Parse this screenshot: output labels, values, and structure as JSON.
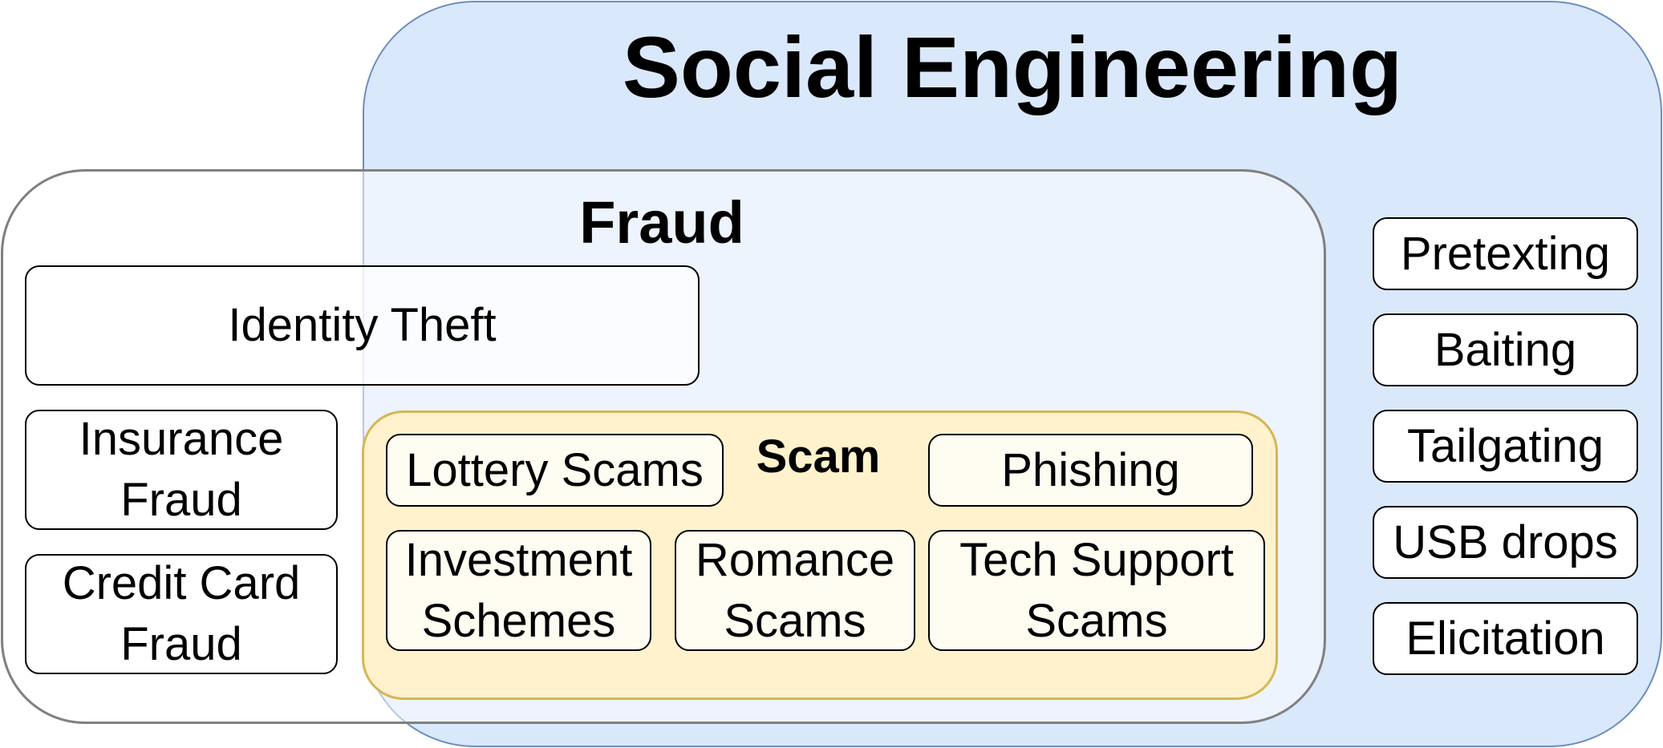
{
  "social_engineering": {
    "title": "Social Engineering",
    "color_fill": "#dae8fc",
    "color_border": "#6c8ebf",
    "techniques": [
      {
        "label": "Pretexting"
      },
      {
        "label": "Baiting"
      },
      {
        "label": "Tailgating"
      },
      {
        "label": "USB drops"
      },
      {
        "label": "Elicitation"
      }
    ]
  },
  "fraud": {
    "title": "Fraud",
    "color_border": "#808080",
    "identity_theft": "Identity Theft",
    "insurance_fraud": {
      "line1": "Insurance",
      "line2": "Fraud"
    },
    "credit_card_fraud": {
      "line1": "Credit Card",
      "line2": "Fraud"
    }
  },
  "scam": {
    "title": "Scam",
    "color_fill": "#fff2cc",
    "color_border": "#d6b656",
    "lottery_scams": "Lottery Scams",
    "phishing": "Phishing",
    "investment_schemes": {
      "line1": "Investment",
      "line2": "Schemes"
    },
    "romance_scams": {
      "line1": "Romance",
      "line2": "Scams"
    },
    "tech_support_scams": {
      "line1": "Tech Support",
      "line2": "Scams"
    }
  }
}
